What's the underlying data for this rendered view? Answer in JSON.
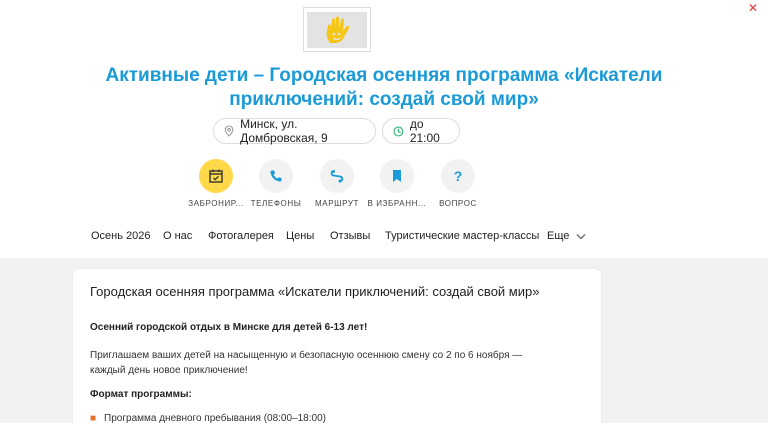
{
  "header": {
    "title": "Активные дети – Городская осенняя программа «Искатели приключений: создай свой мир»"
  },
  "info": {
    "address": "Минск, ул. Домбровская, 9",
    "hours": "до 21:00"
  },
  "actions": [
    {
      "label": "ЗАБРОНИР...",
      "icon": "calendar-icon"
    },
    {
      "label": "ТЕЛЕФОНЫ",
      "icon": "phone-icon"
    },
    {
      "label": "МАРШРУТ",
      "icon": "route-icon"
    },
    {
      "label": "В ИЗБРАНН...",
      "icon": "bookmark-icon"
    },
    {
      "label": "ВОПРОС",
      "icon": "question-icon"
    }
  ],
  "nav": [
    {
      "label": "Осень 2026"
    },
    {
      "label": "О нас"
    },
    {
      "label": "Фотогалерея"
    },
    {
      "label": "Цены"
    },
    {
      "label": "Отзывы"
    },
    {
      "label": "Туристические мастер-классы"
    },
    {
      "label": "Еще"
    }
  ],
  "card": {
    "title": "Городская осенняя программа «Искатели приключений: создай свой мир»",
    "lead": "Осенний городской отдых в Минске для детей 6-13 лет!",
    "para": "Приглашаем ваших детей на насыщенную и безопасную осеннюю смену со 2 по 6 ноября — каждый день новое приключение!",
    "section": "Формат программы:",
    "bullet": "Программа дневного пребывания (08:00–18:00)"
  },
  "colors": {
    "accent_blue": "#1a9bd7",
    "accent_yellow": "#fdd848",
    "close_red": "#e53935",
    "bullet_orange": "#e8702a",
    "hours_green": "#2bb673"
  }
}
